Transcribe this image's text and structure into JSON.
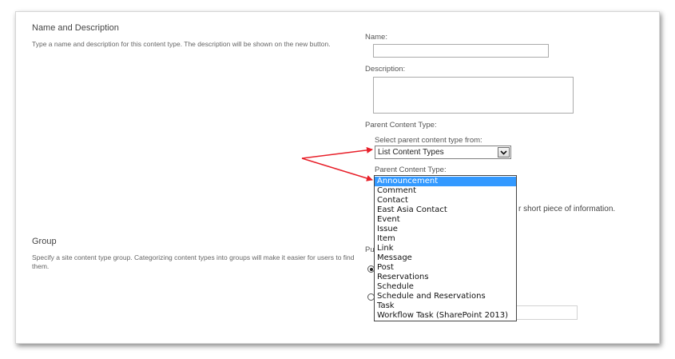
{
  "name_description": {
    "title": "Name and Description",
    "description": "Type a name and description for this content type. The description will be shown on the new button.",
    "name_label": "Name:",
    "name_value": "",
    "description_label": "Description:",
    "description_value": ""
  },
  "parent_content_type": {
    "section_label": "Parent Content Type:",
    "select_label": "Select parent content type from:",
    "select_value": "List Content Types",
    "list_label": "Parent Content Type:",
    "options": [
      "Announcement",
      "Comment",
      "Contact",
      "East Asia Contact",
      "Event",
      "Issue",
      "Item",
      "Link",
      "Message",
      "Post",
      "Reservations",
      "Schedule",
      "Schedule and Reservations",
      "Task",
      "Workflow Task (SharePoint 2013)"
    ],
    "selected_option": "Announcement",
    "hidden_description_fragment": "r short piece of information."
  },
  "group": {
    "title": "Group",
    "description": "Specify a site content type group. Categorizing content types into groups will make it easier for users to find them.",
    "put_label_fragment": "Pu"
  },
  "colors": {
    "selection": "#3399ff",
    "annotation_arrow": "#e8202a"
  },
  "icons": {
    "dropdown": "chevron-down-icon"
  }
}
